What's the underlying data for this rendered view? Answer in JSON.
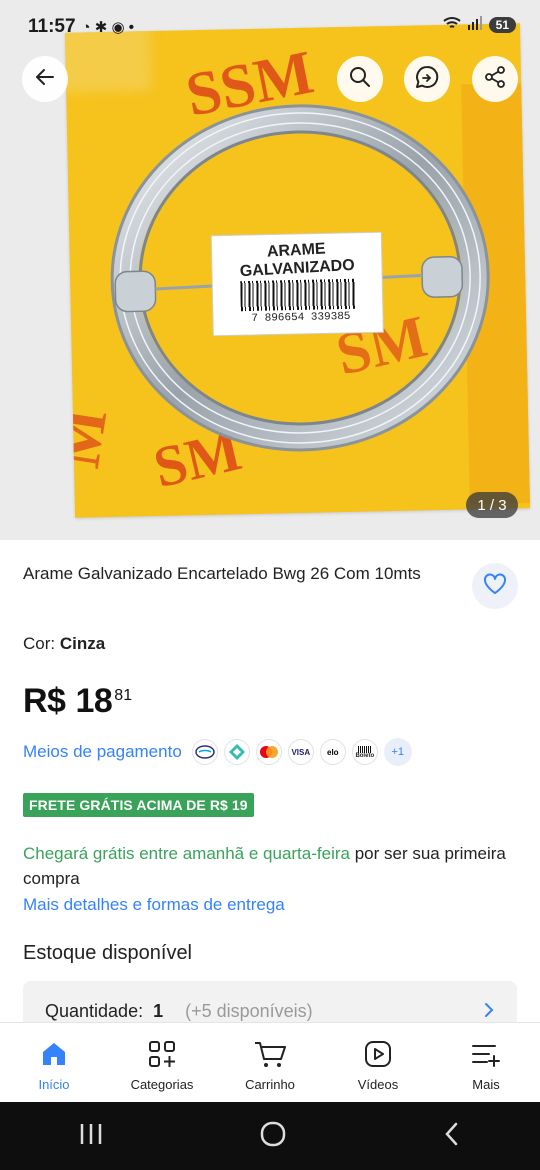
{
  "status": {
    "time": "11:57",
    "battery": "51"
  },
  "gallery": {
    "counter": "1 / 3",
    "label_text": "ARAME GALVANIZADO",
    "barcode_text": "7 896654 339385",
    "brand_text": "SSM"
  },
  "product": {
    "title": "Arame Galvanizado Encartelado Bwg 26 Com 10mts",
    "color_label": "Cor: ",
    "color_value": "Cinza",
    "price": {
      "currency": "R$",
      "integer": "18",
      "cents": "81"
    }
  },
  "payment": {
    "link": "Meios de pagamento",
    "methods": [
      "Mercado Pago",
      "Pix",
      "Mastercard",
      "VISA",
      "elo",
      "Boleto"
    ],
    "more": "+1"
  },
  "shipping": {
    "badge": "FRETE GRÁTIS ACIMA DE R$ 19",
    "delivery_highlight": "Chegará grátis entre amanhã e quarta-feira",
    "delivery_rest": " por ser sua primeira compra",
    "details_link": "Mais detalhes e formas de entrega"
  },
  "stock": {
    "title": "Estoque disponível",
    "quantity_label": "Quantidade:",
    "quantity_value": "1",
    "available": "(+5 disponíveis)"
  },
  "nav": {
    "items": [
      {
        "label": "Início",
        "icon": "home-icon"
      },
      {
        "label": "Categorias",
        "icon": "categories-icon"
      },
      {
        "label": "Carrinho",
        "icon": "cart-icon"
      },
      {
        "label": "Vídeos",
        "icon": "videos-icon"
      },
      {
        "label": "Mais",
        "icon": "menu-more-icon"
      }
    ]
  },
  "colors": {
    "accent": "#3483fa",
    "green": "#3aa35a",
    "card_yellow": "#f6c21c",
    "brand_orange": "#e05818"
  }
}
